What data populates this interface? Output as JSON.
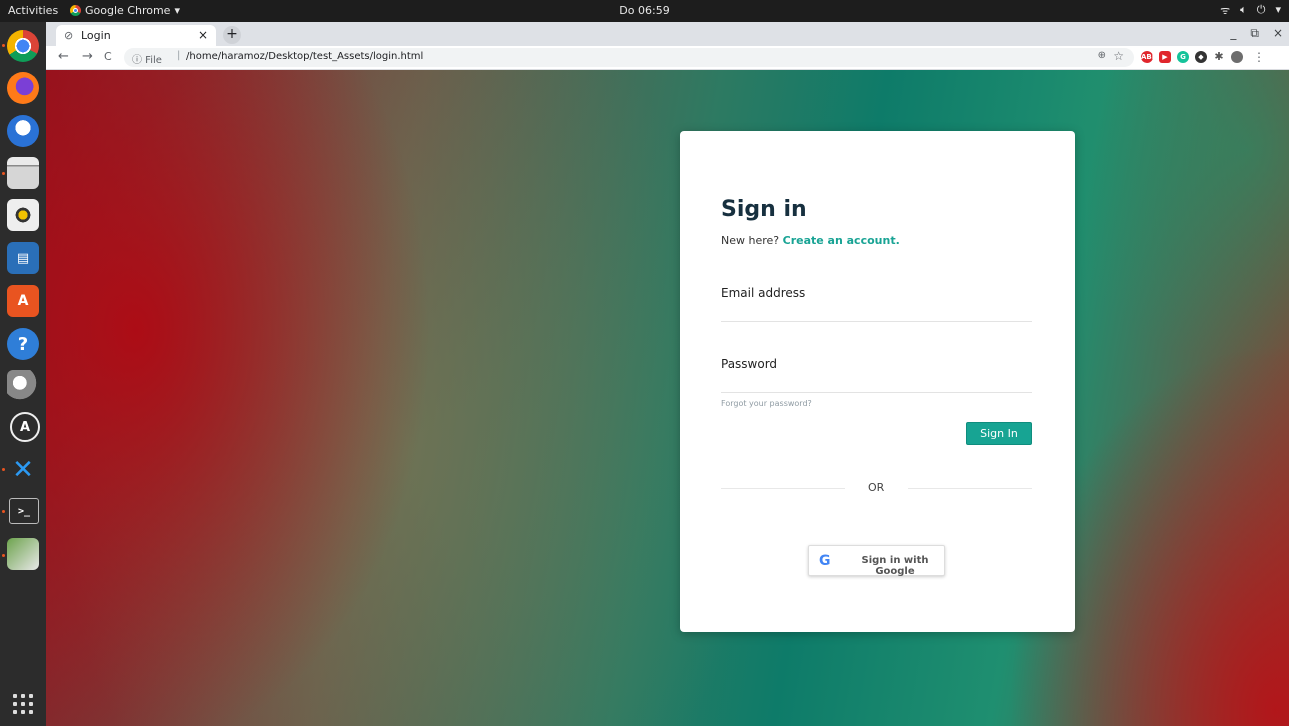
{
  "topbar": {
    "activities": "Activities",
    "app_name": "Google Chrome",
    "app_caret": "▾",
    "clock": "Do 06:59",
    "wifi_icon": "wifi-icon",
    "volume_icon": "volume-icon",
    "power_icon": "power-icon"
  },
  "dock": {
    "items": [
      "chrome-icon",
      "firefox-icon",
      "thunderbird-icon",
      "files-icon",
      "rhythmbox-icon",
      "writer-icon",
      "software-icon",
      "help-icon",
      "network-icon",
      "updater-icon",
      "vscode-icon",
      "terminal-icon",
      "image-viewer-icon"
    ],
    "show_apps": "show-applications-icon"
  },
  "browser": {
    "tab_title": "Login",
    "tab_close": "×",
    "new_tab": "+",
    "back": "←",
    "forward": "→",
    "reload": "C",
    "url_prefix": "ⓘ File",
    "url_sep": "|",
    "url": "/home/haramoz/Desktop/test_Assets/login.html",
    "zoom_icon": "🔍",
    "star": "☆",
    "win_min": "_",
    "win_restore": "⧉",
    "win_close": "×",
    "extensions": [
      {
        "name": "adblock-icon",
        "label": "ABP",
        "color": "#e0262c"
      },
      {
        "name": "extension-red-icon",
        "label": "▶",
        "color": "#e0262c"
      },
      {
        "name": "grammarly-icon",
        "label": "G",
        "color": "#15c39a"
      },
      {
        "name": "extension-dark-icon",
        "label": "◆",
        "color": "#333333"
      },
      {
        "name": "puzzle-icon",
        "label": "✱",
        "color": "#555555"
      },
      {
        "name": "profile-avatar-icon",
        "label": "●",
        "color": "#6d6d6d"
      }
    ],
    "menu": "⋮"
  },
  "login": {
    "heading": "Sign in",
    "new_here": "New here?",
    "create_account": "Create an account.",
    "email_label": "Email address",
    "email_value": "",
    "password_label": "Password",
    "password_value": "",
    "forgot": "Forgot your password?",
    "signin_button": "Sign In",
    "or": "OR",
    "google_g": "G",
    "google_button": "Sign in with Google"
  },
  "colors": {
    "accent": "#18a394",
    "heading": "#17303f"
  }
}
